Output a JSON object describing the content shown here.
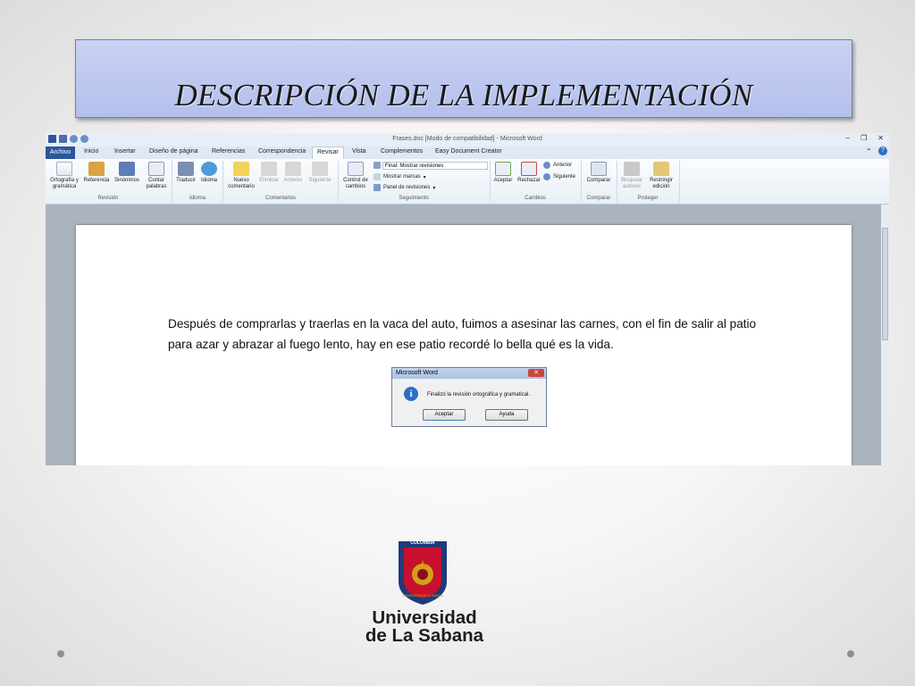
{
  "slide": {
    "title": "DESCRIPCIÓN DE LA IMPLEMENTACIÓN"
  },
  "word": {
    "window_title": "Frases.doc [Modo de compatibilidad] - Microsoft Word",
    "tabs": [
      "Archivo",
      "Inicio",
      "Insertar",
      "Diseño de página",
      "Referencias",
      "Correspondencia",
      "Revisar",
      "Vista",
      "Complementos",
      "Easy Document Creator"
    ],
    "active_tab": "Revisar",
    "ribbon": {
      "revision": {
        "label": "Revisión",
        "ortografia": "Ortografía y gramática",
        "referencia": "Referencia",
        "sinonimos": "Sinónimos",
        "contar": "Contar palabras"
      },
      "idioma": {
        "label": "Idioma",
        "traducir": "Traducir",
        "idioma": "Idioma"
      },
      "comentarios": {
        "label": "Comentarios",
        "nuevo": "Nuevo comentario",
        "eliminar": "Eliminar",
        "anterior": "Anterior",
        "siguiente": "Siguiente"
      },
      "seguimiento": {
        "label": "Seguimiento",
        "control": "Control de cambios",
        "final_dropdown": "Final: Mostrar revisiones",
        "mostrar_marcas": "Mostrar marcas",
        "panel": "Panel de revisiones"
      },
      "cambios": {
        "label": "Cambios",
        "aceptar": "Aceptar",
        "rechazar": "Rechazar",
        "anterior": "Anterior",
        "siguiente": "Siguiente"
      },
      "comparar": {
        "label": "Comparar",
        "comparar": "Comparar"
      },
      "proteger": {
        "label": "Proteger",
        "bloquear": "Bloquear autores",
        "restringir": "Restringir edición"
      }
    },
    "document_text": "Después de comprarlas y traerlas en la vaca del auto, fuimos a asesinar las carnes, con el fin de salir al patio para azar y abrazar al fuego lento, hay en ese patio recordé lo bella qué es la vida.",
    "dialog": {
      "title": "Microsoft Word",
      "message": "Finalizó la revisión ortográfica y gramatical.",
      "ok": "Aceptar",
      "help": "Ayuda"
    }
  },
  "logo": {
    "country": "COLOMBIA",
    "ring_text": "UNIVERSIDAD DE LA SABANA",
    "name_line1": "Universidad",
    "name_line2": "de La Sabana"
  },
  "colors": {
    "title_bg": "#c3ccf1",
    "word_blue": "#2b579a",
    "shield_red": "#c8102e",
    "shield_blue": "#1f3a7a",
    "gold": "#d4a017"
  }
}
